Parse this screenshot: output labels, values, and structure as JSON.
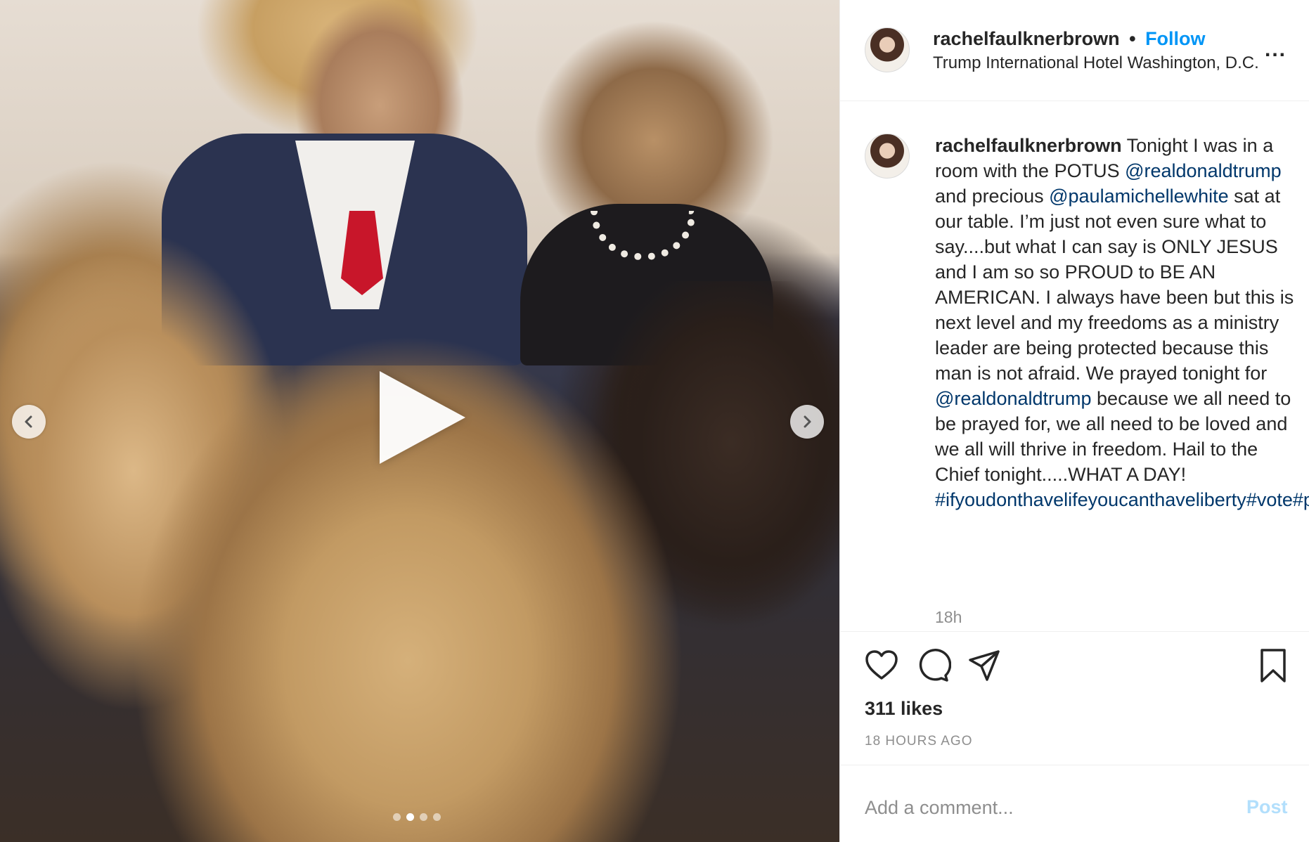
{
  "post": {
    "username": "rachelfaulknerbrown",
    "separator": "•",
    "follow_label": "Follow",
    "location": "Trump International Hotel Washington, D.C.",
    "more_label": "..."
  },
  "media": {
    "type": "video",
    "carousel_count": 4,
    "active_index": 2
  },
  "caption": {
    "username": "rachelfaulknerbrown",
    "text_1": " Tonight I was in a room with the POTUS ",
    "mention_1": "@realdonaldtrump",
    "text_2": " and precious ",
    "mention_2": "@paulamichellewhite",
    "text_3": " sat at our table. I’m just not even sure what to say....but what I can say is ONLY JESUS and I am so so PROUD to BE AN AMERICAN. I always have been but this is next level and my freedoms as a ministry leader are being protected because this man is not afraid. We prayed tonight for ",
    "mention_3": "@realdonaldtrump",
    "text_4": " because we all need to be prayed for, we all need to be loved and we all will thrive in freedom. Hail to the Chief tonight.....WHAT A DAY! ",
    "hashtag_1": "#ifyoudonthavelifeyoucanthaveliberty",
    "hashtag_2": "#vote",
    "hashtag_3": "#prolife",
    "time": "18h"
  },
  "engagement": {
    "likes": "311 likes",
    "posted": "18 HOURS AGO"
  },
  "comment": {
    "placeholder": "Add a comment...",
    "post_label": "Post"
  },
  "colors": {
    "link": "#00376b",
    "follow": "#0095f6",
    "post_disabled": "#b2dffc",
    "muted": "#8e8e8e"
  }
}
